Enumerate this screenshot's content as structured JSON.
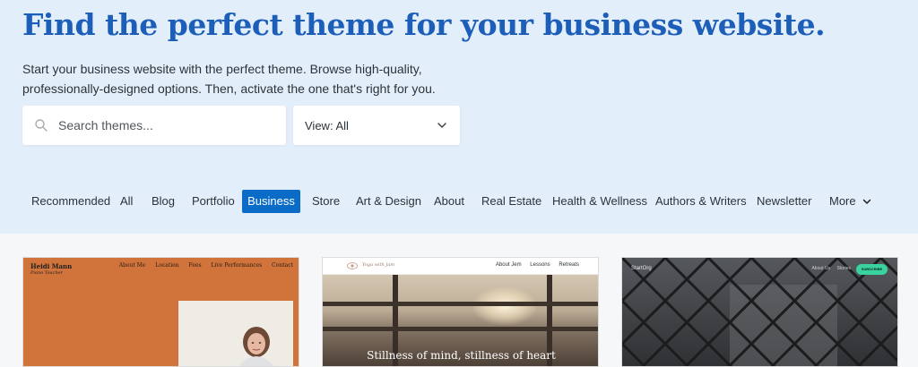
{
  "hero": {
    "title": "Find the perfect theme for your business website.",
    "subtitle": "Start your business website with the perfect theme. Browse high-quality, professionally-designed options. Then, activate the one that's right for you."
  },
  "search": {
    "placeholder": "Search themes..."
  },
  "view_select": {
    "label": "View: All"
  },
  "categories": {
    "items": [
      "Recommended",
      "All",
      "Blog",
      "Portfolio",
      "Business",
      "Store",
      "Art & Design",
      "About",
      "Real Estate",
      "Health & Wellness",
      "Authors & Writers",
      "Newsletter"
    ],
    "active": "Business",
    "more_label": "More"
  },
  "cards": [
    {
      "site_name": "Heidi Mann",
      "site_role": "Piano Teacher",
      "nav": [
        "About Me",
        "Location",
        "Fees",
        "Live Performances",
        "Contact"
      ]
    },
    {
      "brand": "Yoga with Jam",
      "nav": [
        "About Jem",
        "Lessons",
        "Retreats"
      ],
      "tagline": "Stillness of mind, stillness of heart"
    },
    {
      "logo": "StartOrg",
      "nav": [
        "About Us",
        "Stories"
      ],
      "button": "SUBSCRIBE"
    }
  ],
  "colors": {
    "hero_bg": "#e3eefb",
    "title": "#1d5fb8",
    "accent": "#0b6cc7",
    "card1_bg": "#d0743c",
    "card3_button": "#3ad29f"
  },
  "icons": [
    "search-icon",
    "chevron-down-icon",
    "logo-icon"
  ]
}
